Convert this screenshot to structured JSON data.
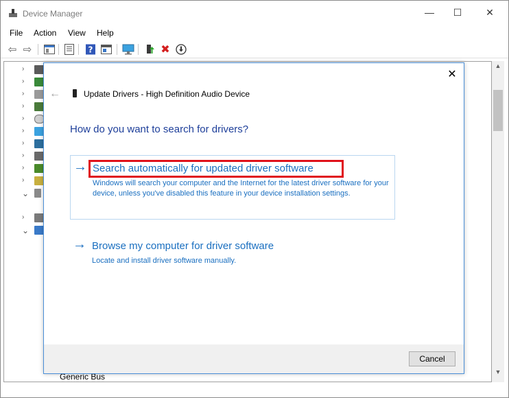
{
  "window": {
    "title": "Device Manager",
    "controls": {
      "minimize": "—",
      "maximize": "☐",
      "close": "✕"
    }
  },
  "menubar": {
    "items": [
      "File",
      "Action",
      "View",
      "Help"
    ]
  },
  "toolbar": {
    "icons": [
      "back-icon",
      "forward-icon",
      "show-hide-tree-icon",
      "properties-icon",
      "help-icon",
      "view-icon",
      "monitor-icon",
      "update-driver-icon",
      "uninstall-icon",
      "download-icon"
    ],
    "uninstall_glyph": "✖",
    "download_glyph": "⬇",
    "back_glyph": "⇦",
    "forward_glyph": "⇨"
  },
  "tree": {
    "expand_collapsed": "›",
    "expand_open": "⌄",
    "bottom_label": "Generic Bus"
  },
  "scrollbar": {
    "up": "▲",
    "down": "▼"
  },
  "dialog": {
    "title": "Update Drivers - High Definition Audio Device",
    "heading": "How do you want to search for drivers?",
    "back_glyph": "←",
    "close_glyph": "✕",
    "options": [
      {
        "arrow": "→",
        "title": "Search automatically for updated driver software",
        "description": "Windows will search your computer and the Internet for the latest driver software for your device, unless you've disabled this feature in your device installation settings."
      },
      {
        "arrow": "→",
        "title": "Browse my computer for driver software",
        "description": "Locate and install driver software manually."
      }
    ],
    "cancel_label": "Cancel"
  },
  "colors": {
    "link_blue": "#1a6fc0",
    "heading_blue": "#1e3f9a",
    "highlight_red": "#e0111a",
    "dialog_border": "#4a8fd8"
  }
}
